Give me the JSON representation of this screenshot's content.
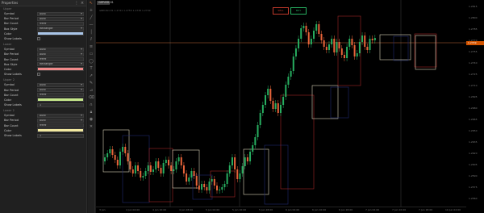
{
  "panel": {
    "title": "Properties",
    "sections": [
      {
        "title": "Upper",
        "rows": [
          {
            "label": "Symbol",
            "value": "Auto",
            "type": "dropdown"
          },
          {
            "label": "Bar Period",
            "value": "Auto",
            "type": "dropdown"
          },
          {
            "label": "Bar Count",
            "value": "9999",
            "type": "text"
          },
          {
            "label": "Box Style",
            "value": "Rectangle",
            "type": "dropdown"
          },
          {
            "label": "Color",
            "color": "#a9c5e8",
            "type": "swatch"
          },
          {
            "label": "Show Labels",
            "type": "check"
          }
        ]
      },
      {
        "title": "Lower",
        "rows": [
          {
            "label": "Symbol",
            "value": "Auto",
            "type": "dropdown"
          },
          {
            "label": "Bar Period",
            "value": "Auto",
            "type": "dropdown"
          },
          {
            "label": "Bar Count",
            "value": "9999",
            "type": "text"
          },
          {
            "label": "Box Style",
            "value": "Rectangle",
            "type": "dropdown"
          },
          {
            "label": "Color",
            "color": "#f08a8a",
            "type": "swatch"
          },
          {
            "label": "Show Labels",
            "type": "check"
          }
        ]
      },
      {
        "title": "Upper 2",
        "rows": [
          {
            "label": "Symbol",
            "value": "Auto",
            "type": "dropdown"
          },
          {
            "label": "Bar Period",
            "value": "Auto",
            "type": "dropdown"
          },
          {
            "label": "Bar Count",
            "value": "9999",
            "type": "text"
          },
          {
            "label": "Color",
            "color": "#c6e88a",
            "type": "swatch"
          },
          {
            "label": "Show Labels",
            "value": "1",
            "type": "text"
          }
        ]
      },
      {
        "title": "Lower 2",
        "rows": [
          {
            "label": "Symbol",
            "value": "Auto",
            "type": "dropdown"
          },
          {
            "label": "Bar Period",
            "value": "Auto",
            "type": "dropdown"
          },
          {
            "label": "Bar Count",
            "value": "9999",
            "type": "text"
          },
          {
            "label": "Color",
            "color": "#f2e9a0",
            "type": "swatch"
          },
          {
            "label": "Show Labels",
            "value": "1",
            "type": "text"
          }
        ]
      }
    ]
  },
  "toolbar": {
    "tools": [
      "cursor-icon",
      "crosshair-icon",
      "line-icon",
      "horizontal-line-icon",
      "vertical-line-icon",
      "channel-icon",
      "fibonacci-icon",
      "rectangle-icon",
      "ellipse-icon",
      "text-icon",
      "arrow-icon",
      "pencil-icon",
      "measure-icon",
      "eraser-icon",
      "magnet-icon",
      "lock-icon",
      "eye-icon",
      "trash-icon"
    ]
  },
  "chart": {
    "tab_label": "GBPUSD,H1",
    "info_text": "GBPUSD,H1  1.2741 1.2755 1.2738 1.2749",
    "sell_label": "SELL",
    "buy_label": "BUY",
    "current_price": "1.2749",
    "price_labels": [
      "1.2815",
      "1.2800",
      "1.2785",
      "1.2770",
      "1.2755",
      "1.2740",
      "1.2725",
      "1.2710",
      "1.2695",
      "1.2680",
      "1.2665",
      "1.2650",
      "1.2635",
      "1.2620",
      "1.2605",
      "1.2590",
      "1.2575",
      "1.2560"
    ],
    "time_labels": [
      "3 Jun",
      "4 Jun 02:00",
      "4 Jun 10:00",
      "4 Jun 18:00",
      "5 Jun 02:00",
      "5 Jun 10:00",
      "5 Jun 18:00",
      "6 Jun 02:00",
      "6 Jun 10:00",
      "6 Jun 18:00",
      "7 Jun 02:00",
      "7 Jun 10:00",
      "7 Jun 18:00",
      "10 Jun 02:00"
    ],
    "colors": {
      "bull": "#27ae60",
      "bear": "#e8643a",
      "box_light": "#d9d2b8",
      "box_red": "#a02525",
      "box_blue": "#1f2a6e",
      "crosshair": "#c06a3a"
    }
  }
}
